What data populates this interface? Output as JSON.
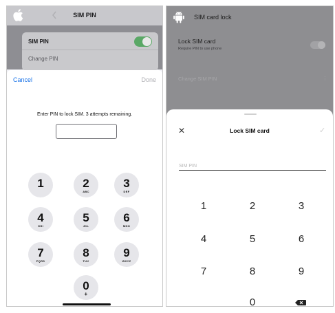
{
  "ios": {
    "nav_title": "SIM PIN",
    "list": {
      "row1_label": "SIM PIN",
      "toggle_on": true,
      "row2_label": "Change PIN"
    },
    "sheet": {
      "cancel": "Cancel",
      "done": "Done",
      "prompt": "Enter PIN to lock SIM. 3 attempts remaining.",
      "pin_value": ""
    },
    "keypad": [
      {
        "digit": "1",
        "letters": ""
      },
      {
        "digit": "2",
        "letters": "ABC"
      },
      {
        "digit": "3",
        "letters": "DEF"
      },
      {
        "digit": "4",
        "letters": "GHI"
      },
      {
        "digit": "5",
        "letters": "JKL"
      },
      {
        "digit": "6",
        "letters": "MNO"
      },
      {
        "digit": "7",
        "letters": "PQRS"
      },
      {
        "digit": "8",
        "letters": "TUV"
      },
      {
        "digit": "9",
        "letters": "WXYZ"
      },
      {
        "digit": "0",
        "letters": "+"
      }
    ]
  },
  "android": {
    "header_title": "SIM card lock",
    "lock_sim": {
      "label": "Lock SIM card",
      "sublabel": "Require PIN to use phone",
      "enabled": false
    },
    "change_pin_label": "Change SIM PIN",
    "sheet": {
      "title": "Lock SIM card",
      "close_icon": "close-icon",
      "confirm_icon": "check-icon",
      "placeholder": "SIM PIN"
    },
    "keypad": [
      "1",
      "2",
      "3",
      "4",
      "5",
      "6",
      "7",
      "8",
      "9",
      "0"
    ],
    "backspace_icon": "backspace-icon"
  },
  "colors": {
    "ios_accent": "#1a73e8",
    "ios_toggle_on": "#5aa866",
    "dim_overlay": "#8e8e91"
  }
}
